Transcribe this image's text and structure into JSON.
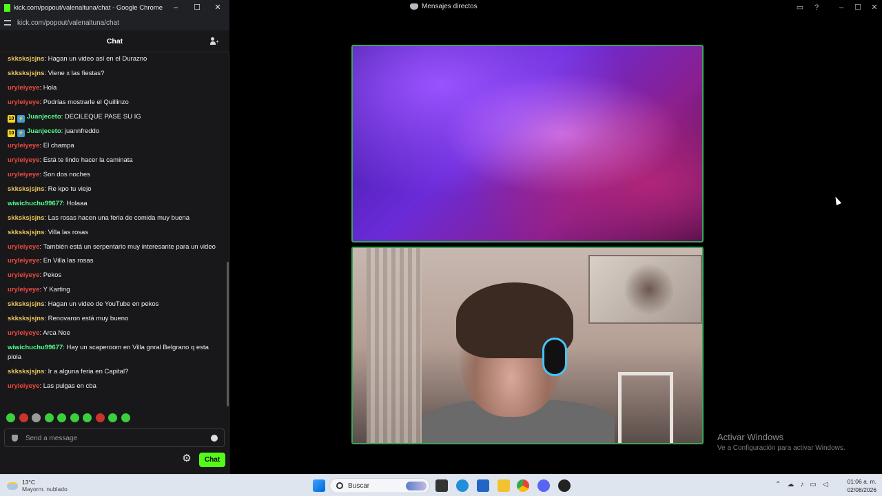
{
  "discord": {
    "title": "Mensajes directos",
    "watermark_line1": "Activar Windows",
    "watermark_line2": "Ve a Configuración para activar Windows."
  },
  "chrome": {
    "window_title": "kick.com/popout/valenaltuna/chat - Google Chrome",
    "url": "kick.com/popout/valenaltuna/chat"
  },
  "chat": {
    "title": "Chat",
    "input_placeholder": "Send a message",
    "send_label": "Chat",
    "messages": [
      {
        "user": "skksksjsjns",
        "color": "#e8c45a",
        "badges": [],
        "text": "Hagan un video así en el Durazno"
      },
      {
        "user": "skksksjsjns",
        "color": "#e8c45a",
        "badges": [],
        "text": "Viene x las fiestas?"
      },
      {
        "user": "uryleiyeye",
        "color": "#ef4a3d",
        "badges": [],
        "text": "Hola"
      },
      {
        "user": "uryleiyeye",
        "color": "#ef4a3d",
        "badges": [],
        "text": "Podrías mostrarle el Quillinzo"
      },
      {
        "user": "Juanjeceto",
        "color": "#53fc8a",
        "badges": [
          "10",
          "bolt"
        ],
        "text": "DECILEQUE PASE SU IG"
      },
      {
        "user": "Juanjeceto",
        "color": "#53fc8a",
        "badges": [
          "10",
          "bolt"
        ],
        "text": "juannfreddo"
      },
      {
        "user": "uryleiyeye",
        "color": "#ef4a3d",
        "badges": [],
        "text": "El champa"
      },
      {
        "user": "uryleiyeye",
        "color": "#ef4a3d",
        "badges": [],
        "text": "Está te lindo hacer la caminata"
      },
      {
        "user": "uryleiyeye",
        "color": "#ef4a3d",
        "badges": [],
        "text": "Son dos noches"
      },
      {
        "user": "skksksjsjns",
        "color": "#e8c45a",
        "badges": [],
        "text": "Re kpo tu viejo"
      },
      {
        "user": "wiwichuchu99677",
        "color": "#53fc8a",
        "badges": [],
        "text": "Holaaa"
      },
      {
        "user": "skksksjsjns",
        "color": "#e8c45a",
        "badges": [],
        "text": "Las rosas hacen una feria de comida muy buena"
      },
      {
        "user": "skksksjsjns",
        "color": "#e8c45a",
        "badges": [],
        "text": "Villa las rosas"
      },
      {
        "user": "uryleiyeye",
        "color": "#ef4a3d",
        "badges": [],
        "text": "También está un serpentario muy interesante para un video"
      },
      {
        "user": "uryleiyeye",
        "color": "#ef4a3d",
        "badges": [],
        "text": "En Villa las rosas"
      },
      {
        "user": "uryleiyeye",
        "color": "#ef4a3d",
        "badges": [],
        "text": "Pekos"
      },
      {
        "user": "uryleiyeye",
        "color": "#ef4a3d",
        "badges": [],
        "text": "Y Karting"
      },
      {
        "user": "skksksjsjns",
        "color": "#e8c45a",
        "badges": [],
        "text": "Hagan un video de YouTube en pekos"
      },
      {
        "user": "skksksjsjns",
        "color": "#e8c45a",
        "badges": [],
        "text": "Renovaron está muy bueno"
      },
      {
        "user": "uryleiyeye",
        "color": "#ef4a3d",
        "badges": [],
        "text": "Arca Noe"
      },
      {
        "user": "wiwichuchu99677",
        "color": "#53fc8a",
        "badges": [],
        "text": "Hay un scaperoom en Villa gnral Belgrano q esta piola"
      },
      {
        "user": "skksksjsjns",
        "color": "#e8c45a",
        "badges": [],
        "text": "Ir a alguna feria en Capital?"
      },
      {
        "user": "uryleiyeye",
        "color": "#ef4a3d",
        "badges": [],
        "text": "Las pulgas en cba"
      }
    ],
    "emotes": [
      "green",
      "red",
      "grey",
      "green",
      "green",
      "green",
      "green",
      "red",
      "green",
      "green"
    ]
  },
  "taskbar": {
    "temperature": "13°C",
    "condition": "Mayorm. nublado",
    "search_label": "Buscar",
    "time": "01:06 a. m.",
    "date": "02/08/2026"
  }
}
